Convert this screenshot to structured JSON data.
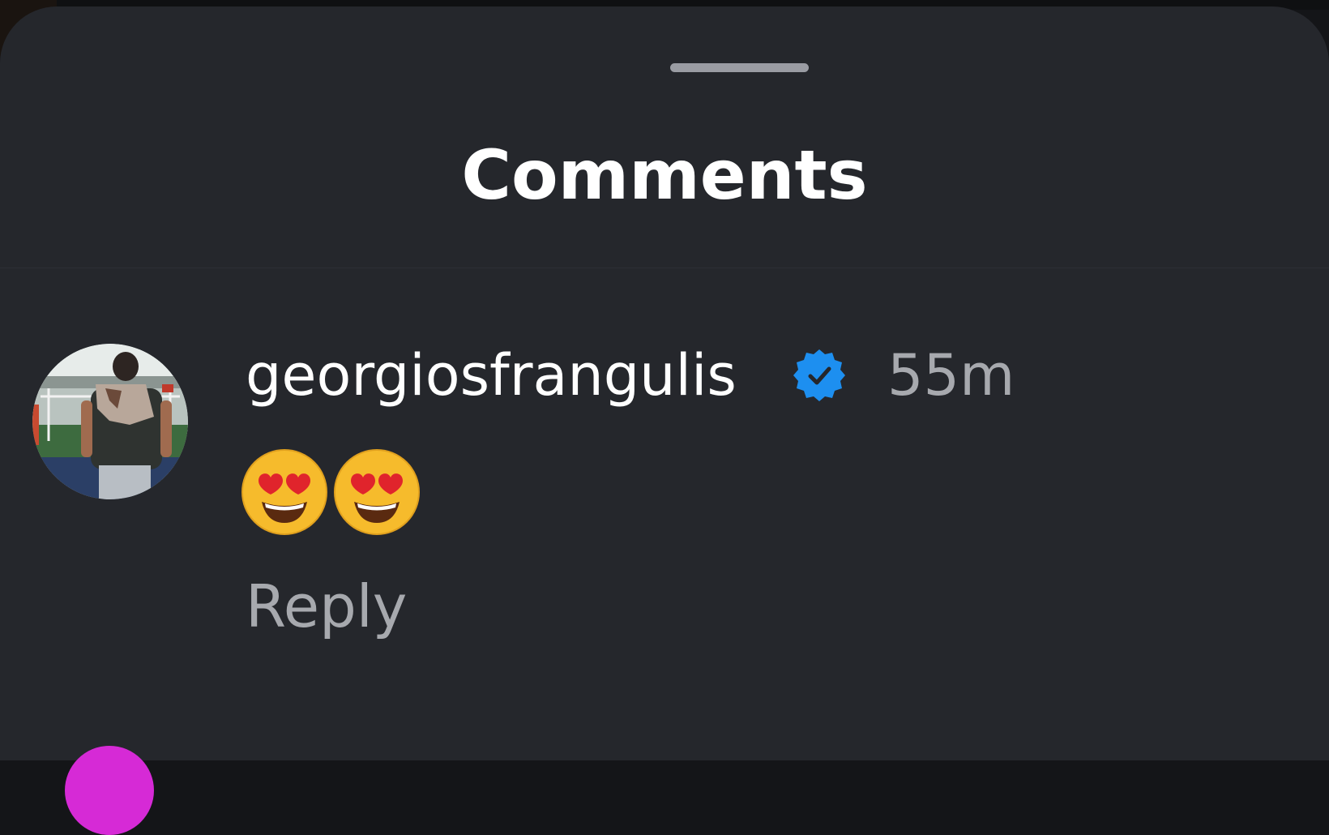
{
  "sheet": {
    "title": "Comments"
  },
  "comment": {
    "username": "georgiosfrangulis",
    "verified_icon": "verified-badge-icon",
    "timestamp": "55m",
    "emojis": [
      "smiling-face-with-heart-eyes",
      "smiling-face-with-heart-eyes"
    ],
    "reply_label": "Reply"
  },
  "colors": {
    "sheet_background": "#25272c",
    "verified_badge": "#1d8ff0",
    "secondary_text": "#a7a9ae",
    "next_avatar_ring": "#d62ad6"
  }
}
